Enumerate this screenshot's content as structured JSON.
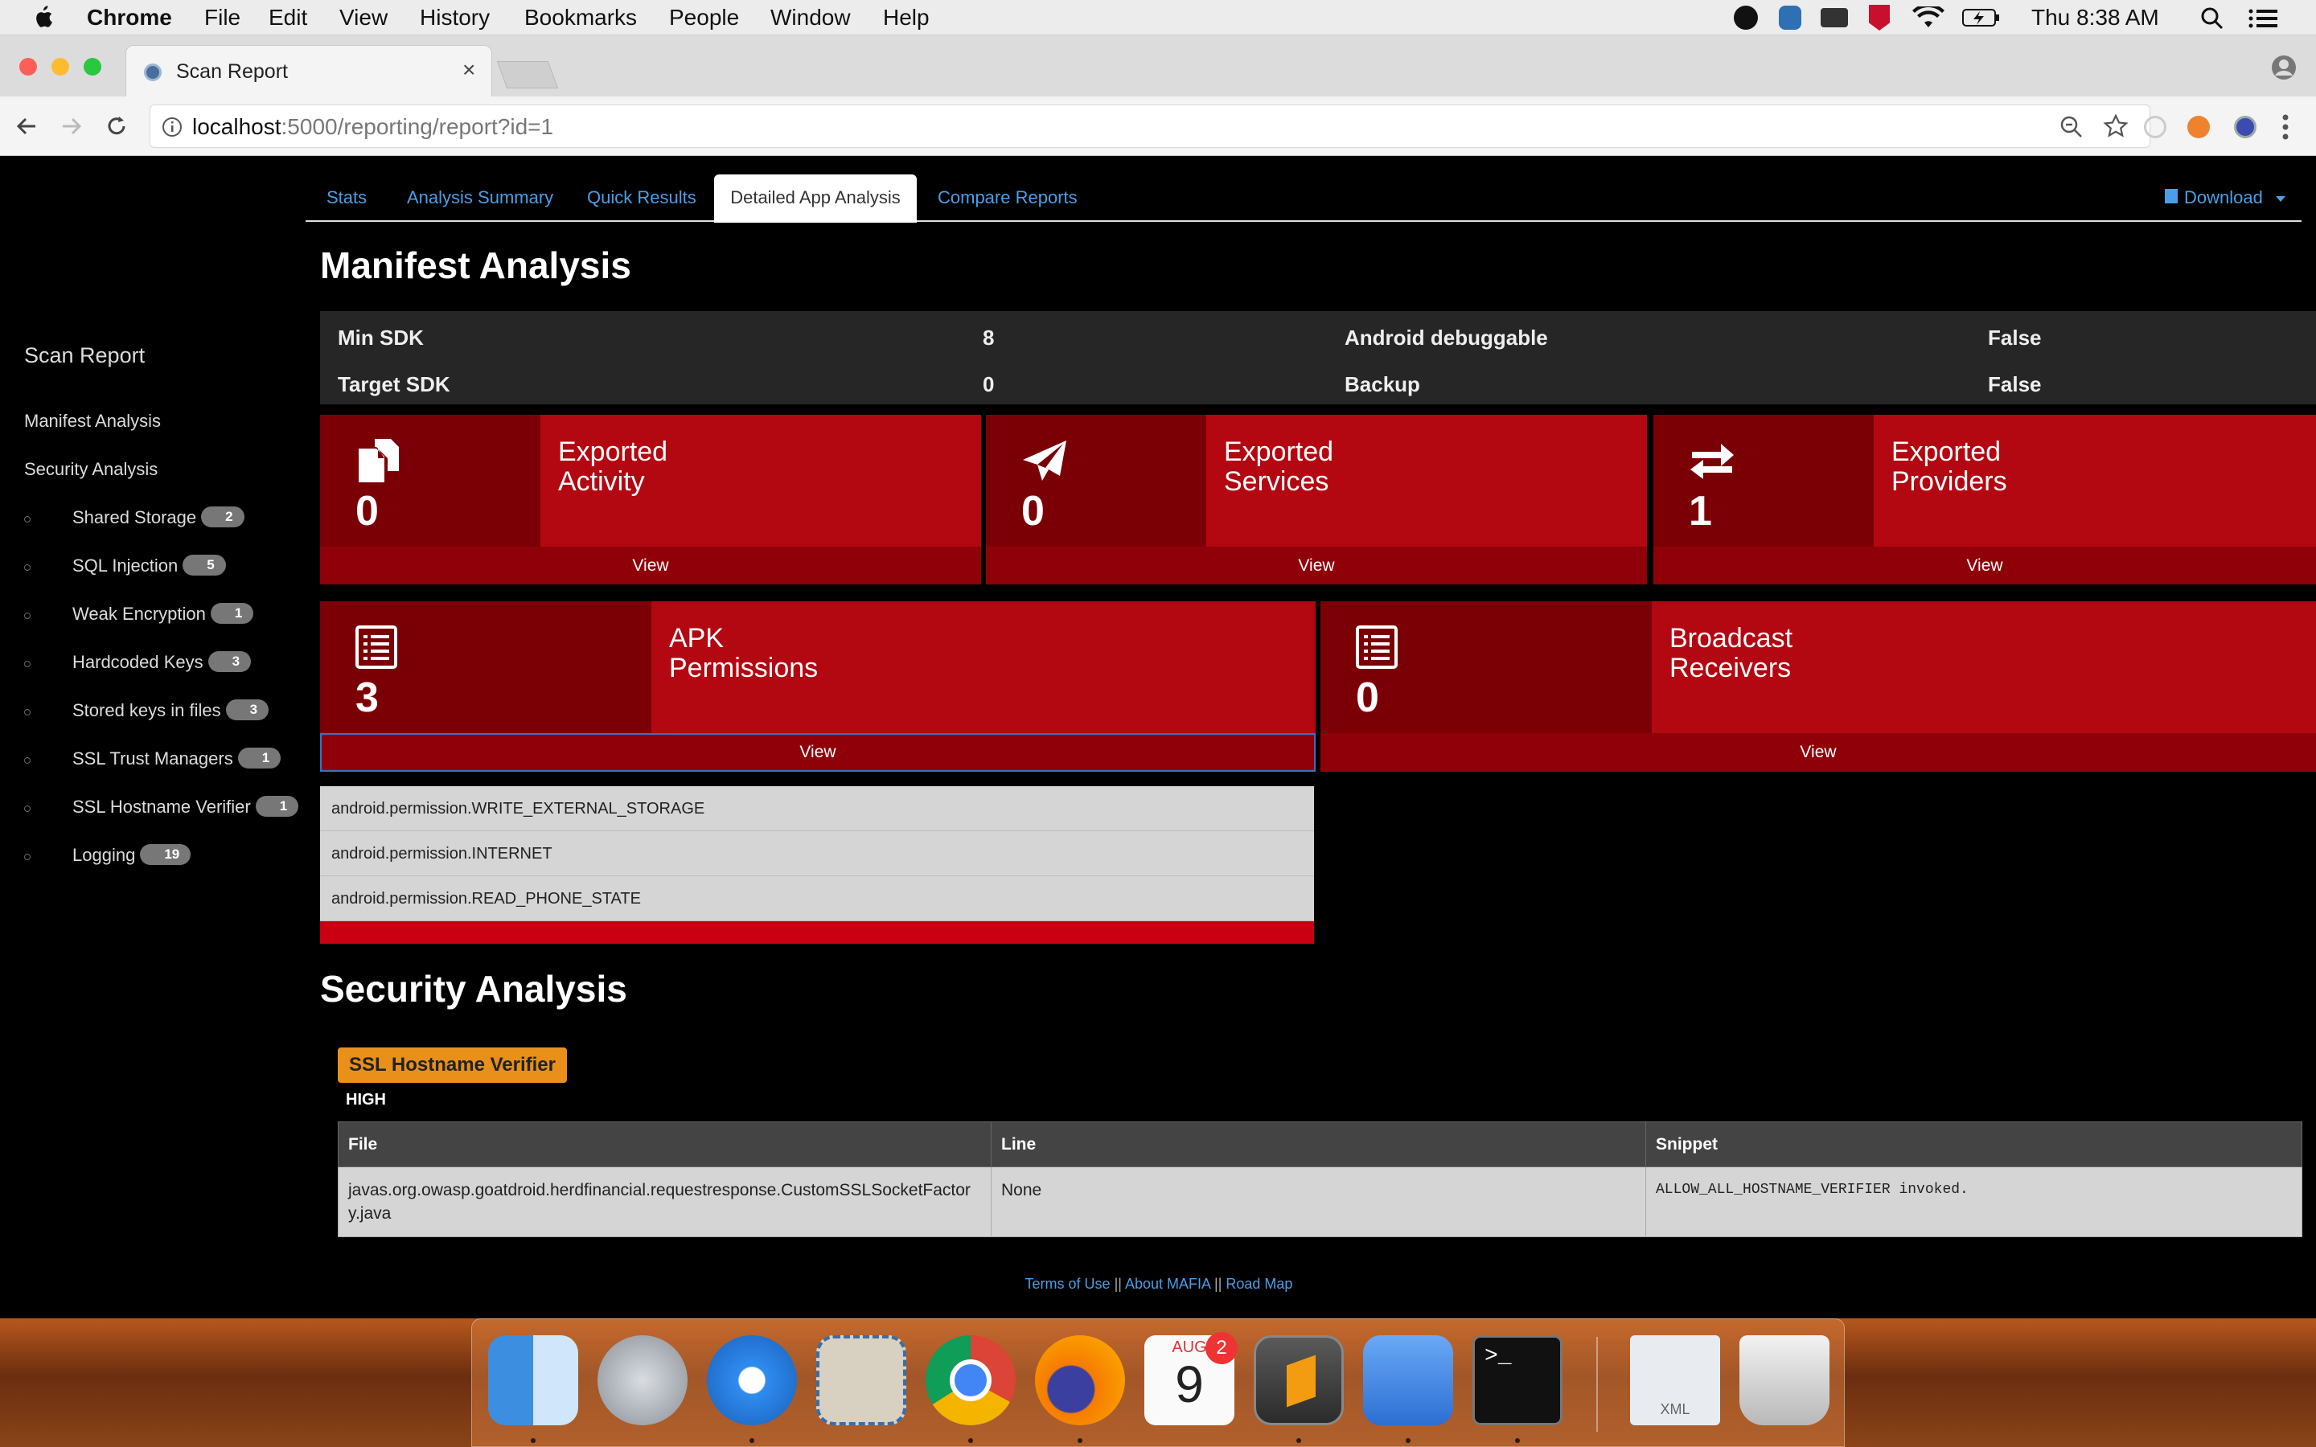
{
  "menubar": {
    "app": "Chrome",
    "items": [
      "File",
      "Edit",
      "View",
      "History",
      "Bookmarks",
      "People",
      "Window",
      "Help"
    ],
    "clock": "Thu 8:38 AM"
  },
  "browser": {
    "tab_title": "Scan Report",
    "url_host": "localhost",
    "url_path": ":5000/reporting/report?id=1"
  },
  "nav": {
    "tabs": [
      "Stats",
      "Analysis Summary",
      "Quick Results",
      "Detailed App Analysis",
      "Compare Reports"
    ],
    "active": "Detailed App Analysis",
    "download": "Download"
  },
  "sidebar": {
    "title": "Scan Report",
    "manifest": "Manifest Analysis",
    "security": "Security Analysis",
    "items": [
      {
        "label": "Shared Storage",
        "count": "2"
      },
      {
        "label": "SQL Injection",
        "count": "5"
      },
      {
        "label": "Weak Encryption",
        "count": "1"
      },
      {
        "label": "Hardcoded Keys",
        "count": "3"
      },
      {
        "label": "Stored keys in files",
        "count": "3"
      },
      {
        "label": "SSL Trust Managers",
        "count": "1"
      },
      {
        "label": "SSL Hostname Verifier",
        "count": "1"
      },
      {
        "label": "Logging",
        "count": "19"
      }
    ]
  },
  "manifest": {
    "heading": "Manifest Analysis",
    "min_sdk_label": "Min SDK",
    "min_sdk": "8",
    "target_sdk_label": "Target SDK",
    "target_sdk": "0",
    "debuggable_label": "Android debuggable",
    "debuggable": "False",
    "backup_label": "Backup",
    "backup": "False"
  },
  "cards": {
    "activity": {
      "line1": "Exported",
      "line2": "Activity",
      "count": "0",
      "view": "View"
    },
    "services": {
      "line1": "Exported",
      "line2": "Services",
      "count": "0",
      "view": "View"
    },
    "providers": {
      "line1": "Exported",
      "line2": "Providers",
      "count": "1",
      "view": "View"
    },
    "permissions": {
      "line1": "APK",
      "line2": "Permissions",
      "count": "3",
      "view": "View"
    },
    "receivers": {
      "line1": "Broadcast",
      "line2": "Receivers",
      "count": "0",
      "view": "View"
    }
  },
  "permissions": [
    "android.permission.WRITE_EXTERNAL_STORAGE",
    "android.permission.INTERNET",
    "android.permission.READ_PHONE_STATE"
  ],
  "security": {
    "heading": "Security Analysis",
    "finding_label": "SSL Hostname Verifier",
    "severity": "HIGH",
    "columns": [
      "File",
      "Line",
      "Snippet"
    ],
    "rows": [
      {
        "file": "javas.org.owasp.goatdroid.herdfinancial.requestresponse.CustomSSLSocketFactory.java",
        "line": "None",
        "snippet": "ALLOW_ALL_HOSTNAME_VERIFIER invoked."
      }
    ]
  },
  "footer": {
    "terms": "Terms of Use",
    "sep1": " || ",
    "about": "About MAFIA",
    "sep2": " || ",
    "roadmap": "Road Map"
  },
  "dock": {
    "calendar_month": "AUG",
    "calendar_day": "9",
    "calendar_badge": "2",
    "xml_label": "XML"
  },
  "colors": {
    "card_dark": "#7b0006",
    "card_main": "#b30711",
    "link_blue": "#4a9fe8",
    "finding_orange": "#e8901a"
  }
}
